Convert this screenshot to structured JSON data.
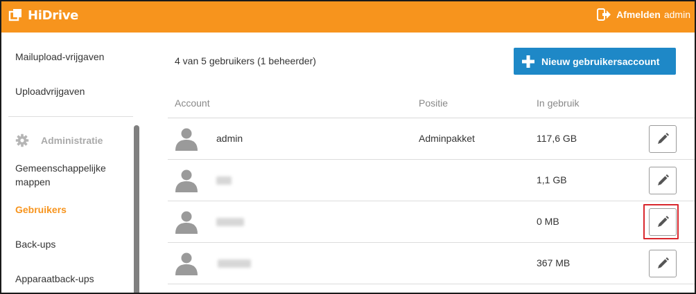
{
  "header": {
    "brand": "HiDrive",
    "logout_label": "Afmelden",
    "logout_user": "admin",
    "brand_color": "#f7941d"
  },
  "sidebar": {
    "items_top": [
      {
        "label": "Mailupload-vrijgaven"
      },
      {
        "label": "Uploadvrijgaven"
      }
    ],
    "section": {
      "label": "Administratie",
      "icon": "gear-icon"
    },
    "items": [
      {
        "label": "Gemeenschappelijke mappen",
        "active": false
      },
      {
        "label": "Gebruikers",
        "active": true
      },
      {
        "label": "Back-ups",
        "active": false
      },
      {
        "label": "Apparaatback-ups",
        "active": false
      }
    ]
  },
  "main": {
    "count_text": "4 van 5 gebruikers (1 beheerder)",
    "new_button_label": "Nieuw gebruikersaccount",
    "accent_color": "#1e88c7",
    "columns": [
      "Account",
      "Positie",
      "In gebruik"
    ],
    "rows": [
      {
        "account": "admin",
        "position": "Adminpakket",
        "usage": "117,6 GB",
        "account_redacted": false
      },
      {
        "account": "",
        "position": "",
        "usage": "1,1 GB",
        "account_redacted": true
      },
      {
        "account": "",
        "position": "",
        "usage": "0 MB",
        "account_redacted": true,
        "highlighted": true
      },
      {
        "account": "",
        "position": "",
        "usage": "367 MB",
        "account_redacted": true
      }
    ]
  }
}
